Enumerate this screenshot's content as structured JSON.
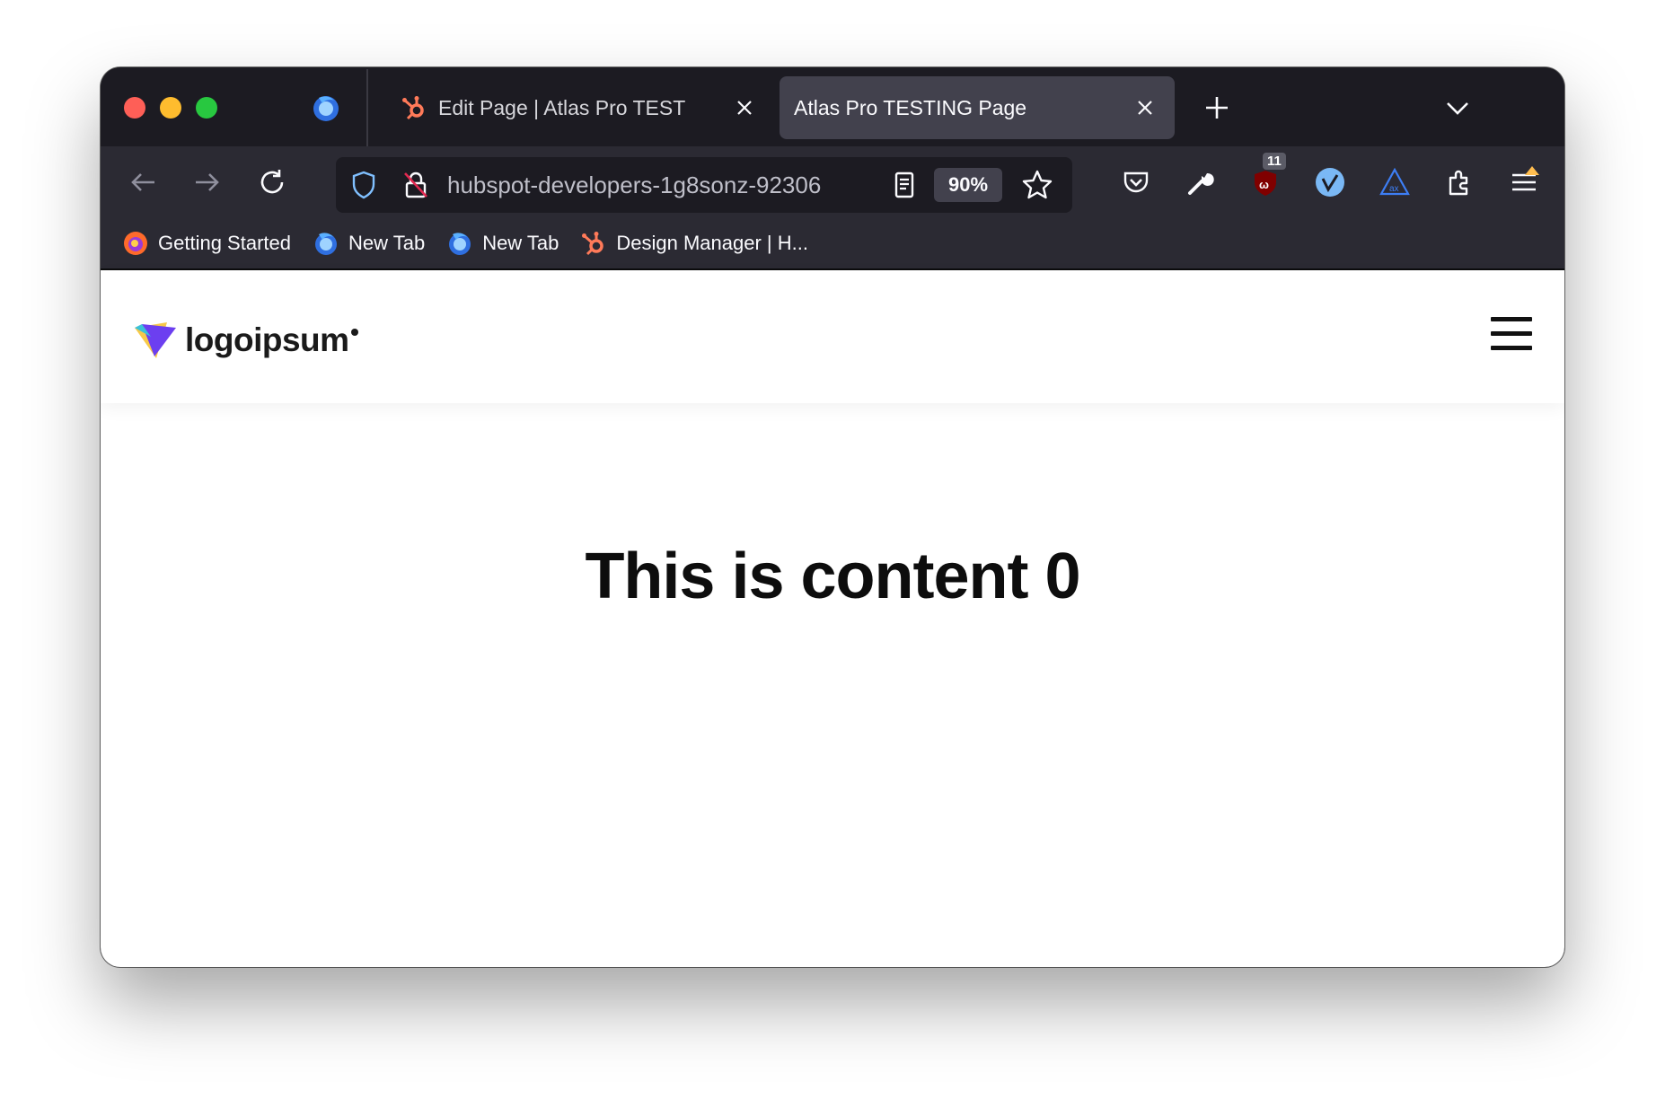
{
  "browser": {
    "tabs": [
      {
        "label": "Edit Page | Atlas Pro TEST",
        "icon": "hubspot-icon",
        "active": false
      },
      {
        "label": "Atlas Pro TESTING Page",
        "icon": "none",
        "active": true
      }
    ],
    "url": "hubspot-developers-1g8sonz-92306",
    "zoom": "90%",
    "extension_badge_count": "11",
    "bookmarks": [
      {
        "label": "Getting Started",
        "icon": "firefox-icon"
      },
      {
        "label": "New Tab",
        "icon": "firefox-icon"
      },
      {
        "label": "New Tab",
        "icon": "firefox-icon"
      },
      {
        "label": "Design Manager | H...",
        "icon": "hubspot-icon"
      }
    ],
    "colors": {
      "chrome_dark": "#1c1b22",
      "toolbar": "#2b2a33",
      "active_tab": "#42414d",
      "hubspot_orange": "#ff7a59"
    }
  },
  "site": {
    "logo_text": "logoipsum",
    "heading": "This is content 0"
  }
}
